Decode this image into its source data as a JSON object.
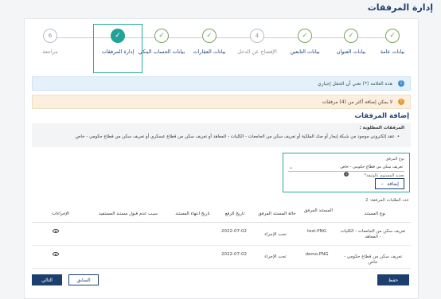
{
  "page": {
    "title": "إدارة المرفقات"
  },
  "stepper": {
    "steps": [
      {
        "label": "بيانات عامة",
        "state": "done",
        "num": ""
      },
      {
        "label": "بيانات العنوان",
        "state": "done",
        "num": ""
      },
      {
        "label": "بيانات التابعين",
        "state": "done",
        "num": ""
      },
      {
        "label": "الإفصاح عن الدخل",
        "state": "pending",
        "num": "4"
      },
      {
        "label": "بيانات العقارات",
        "state": "done",
        "num": ""
      },
      {
        "label": "بيانات الحساب البنكي",
        "state": "done",
        "num": ""
      },
      {
        "label": "إدارة المرفقات",
        "state": "active",
        "num": ""
      },
      {
        "label": "مراجعة",
        "state": "pending",
        "num": "6"
      }
    ]
  },
  "alerts": {
    "info": "هذه العلامة (*) تعني أن الحقل إجباري",
    "warning": "لا يمكن إضافة أكثر من (4) مرفقات"
  },
  "section": {
    "title": "إضافة المرفقات",
    "required_title": "المرفقات المطلوبة :",
    "required_item": "عقد إلكتروني موجود من شبكة إيجار أو صك الملكية أو تعريف سكن من الجامعات - الكليات - المعاهد أو تعريف سكن من قطاع عسكري أو تعريف سكن من قطاع حكومي - خاص"
  },
  "upload": {
    "type_label": "نوع المرفق",
    "type_value": "تعريف سكن من قطاع حكومي - خاص",
    "file_label": "تحديد المستوى بالوثيقة*",
    "add_label": "إضافة"
  },
  "table": {
    "count_label": "عدد الطلبات المرفقة: 2",
    "headers": {
      "type": "نوع المستند",
      "doc": "المستند المرفق",
      "status": "حالة المستند المرفق",
      "upload_date": "تاريخ الرفع",
      "expiry": "تاريخ انتهاء المستند",
      "reject_reason": "سبب عدم قبول مستند المستفيد",
      "actions": "الإجراءات"
    },
    "rows": [
      {
        "type": "تعريف سكن من الجامعات - الكليات - المعاهد",
        "doc": "test.PNG",
        "status": "تحت الإجراء",
        "upload_date": "2022-07-02",
        "expiry": "",
        "reject_reason": ""
      },
      {
        "type": "تعريف سكن من قطاع حكومي - خاص",
        "doc": "demo.PNG",
        "status": "تحت الإجراء",
        "upload_date": "2022-07-02",
        "expiry": "",
        "reject_reason": ""
      }
    ]
  },
  "footer": {
    "save": "حفظ",
    "prev": "السابق",
    "next": "التالي"
  },
  "colors": {
    "primary": "#1d3f70",
    "teal": "#2aa8a0",
    "success": "#7aa35a"
  }
}
